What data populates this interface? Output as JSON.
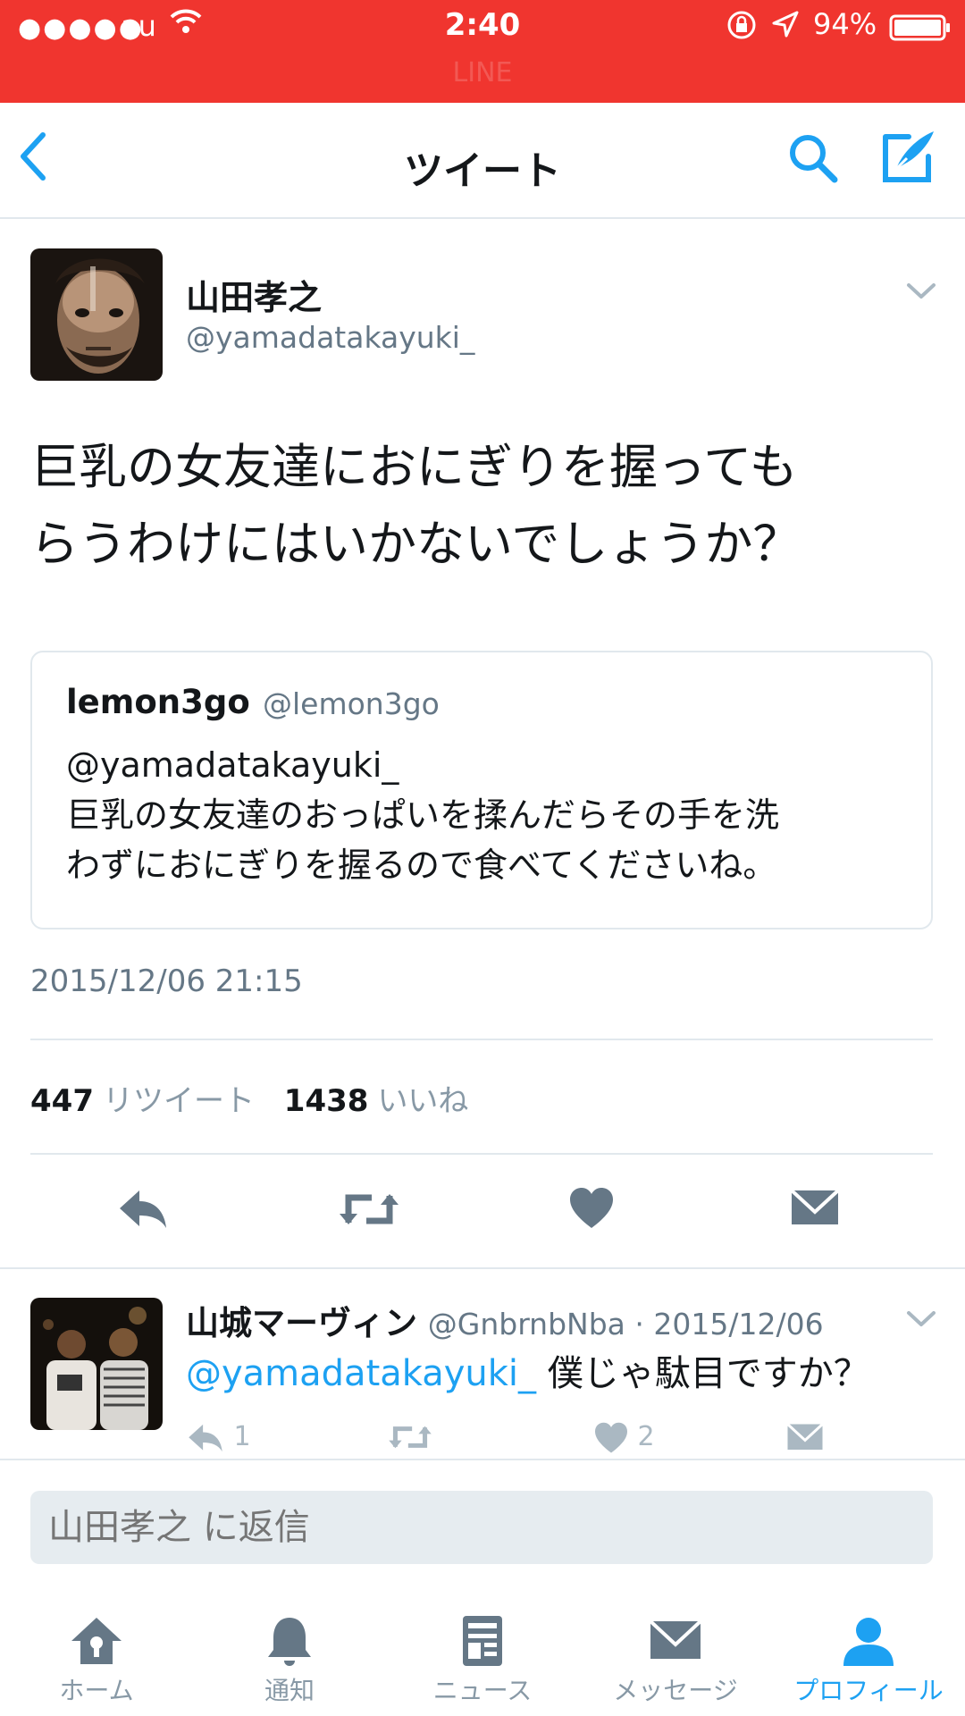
{
  "status_bar": {
    "signal_dots": "●●●●●",
    "carrier": "au",
    "time": "2:40",
    "battery": "94%",
    "app_watermark": "LINE",
    "background_color": "#f0352f"
  },
  "nav": {
    "title": "ツイート",
    "back_icon": "chevron-left-icon",
    "search_icon": "search-icon",
    "compose_icon": "compose-icon"
  },
  "tweet": {
    "author_name": "山田孝之",
    "author_handle": "@yamadatakayuki_",
    "text_line1": "巨乳の女友達におにぎりを握っても",
    "text_line2": "らうわけにはいかないでしょうか？",
    "quote": {
      "name": "lemon3go",
      "handle": "@lemon3go",
      "line1": "@yamadatakayuki_",
      "line2": "巨乳の女友達のおっぱいを揉んだらその手を洗",
      "line3": "わずにおにぎりを握るので食べてくださいね。"
    },
    "timestamp": "2015/12/06 21:15",
    "retweets": "447",
    "retweets_label": "リツイート",
    "likes": "1438",
    "likes_label": "いいね"
  },
  "reply": {
    "name": "山城マーヴィン",
    "meta": "@GnbrnbNba · 2015/12/06",
    "mention": "@yamadatakayuki_",
    "text": " 僕じゃ駄目ですか？",
    "reply_count": "1",
    "like_count": "2"
  },
  "reply_input": {
    "placeholder": "山田孝之 に返信"
  },
  "tabs": [
    {
      "label": "ホーム",
      "icon": "home-icon"
    },
    {
      "label": "通知",
      "icon": "bell-icon"
    },
    {
      "label": "ニュース",
      "icon": "news-icon"
    },
    {
      "label": "メッセージ",
      "icon": "envelope-icon"
    },
    {
      "label": "プロフィール",
      "icon": "person-icon"
    }
  ],
  "colors": {
    "accent": "#1da1f2",
    "icon_gray": "#657786",
    "muted": "#8899a6"
  }
}
